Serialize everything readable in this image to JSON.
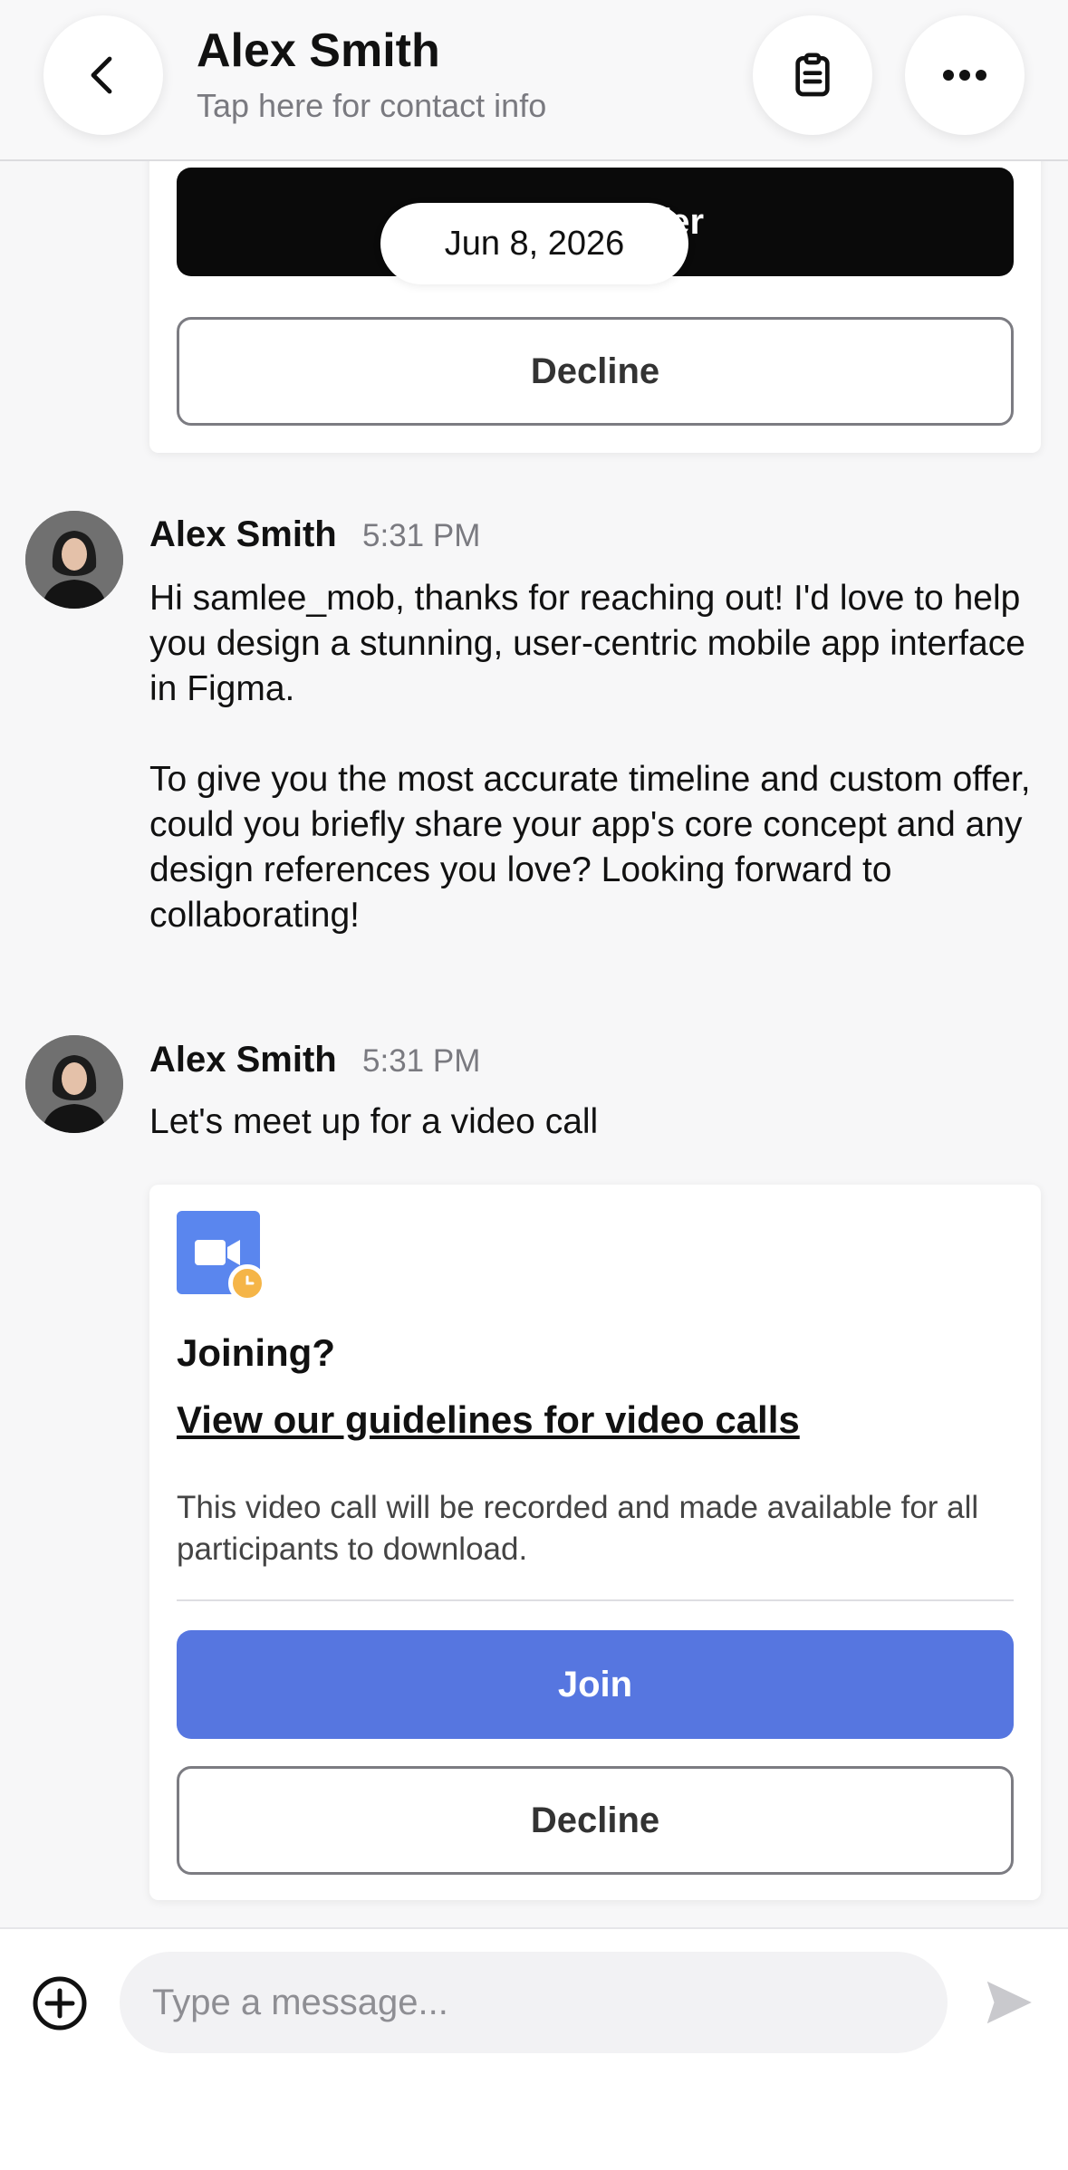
{
  "header": {
    "contact_name": "Alex Smith",
    "contact_subtitle": "Tap here for contact info",
    "back_icon": "chevron-left-icon",
    "notes_icon": "clipboard-icon",
    "more_icon": "ellipsis-icon"
  },
  "feed": {
    "date_pill": "Jun 8, 2026",
    "offer_card": {
      "accept_label": "Accept Offer",
      "decline_label": "Decline"
    },
    "messages": [
      {
        "sender": "Alex Smith",
        "time": "5:31 PM",
        "paragraphs": [
          "Hi samlee_mob, thanks for reaching out! I'd love to help you design a stunning, user-centric mobile app interface in Figma.",
          "To give you the most accurate timeline and custom offer, could you briefly share your app's core concept and any design references you love? Looking forward to collaborating!"
        ]
      },
      {
        "sender": "Alex Smith",
        "time": "5:31 PM",
        "text": "Let's meet up for a video call"
      }
    ],
    "call_card": {
      "icon": "video-camera-icon",
      "badge_icon": "clock-icon",
      "title": "Joining?",
      "guidelines_link": "View our guidelines for video calls",
      "note": "This video call will be recorded and made available for all participants to download.",
      "join_label": "Join",
      "decline_label": "Decline"
    }
  },
  "composer": {
    "placeholder": "Type a message...",
    "value": "",
    "add_icon": "plus-circle-icon",
    "send_icon": "send-icon"
  },
  "colors": {
    "accent": "#5676e0",
    "video_icon_bg": "#5a86ee",
    "clock_badge": "#f5b548"
  }
}
